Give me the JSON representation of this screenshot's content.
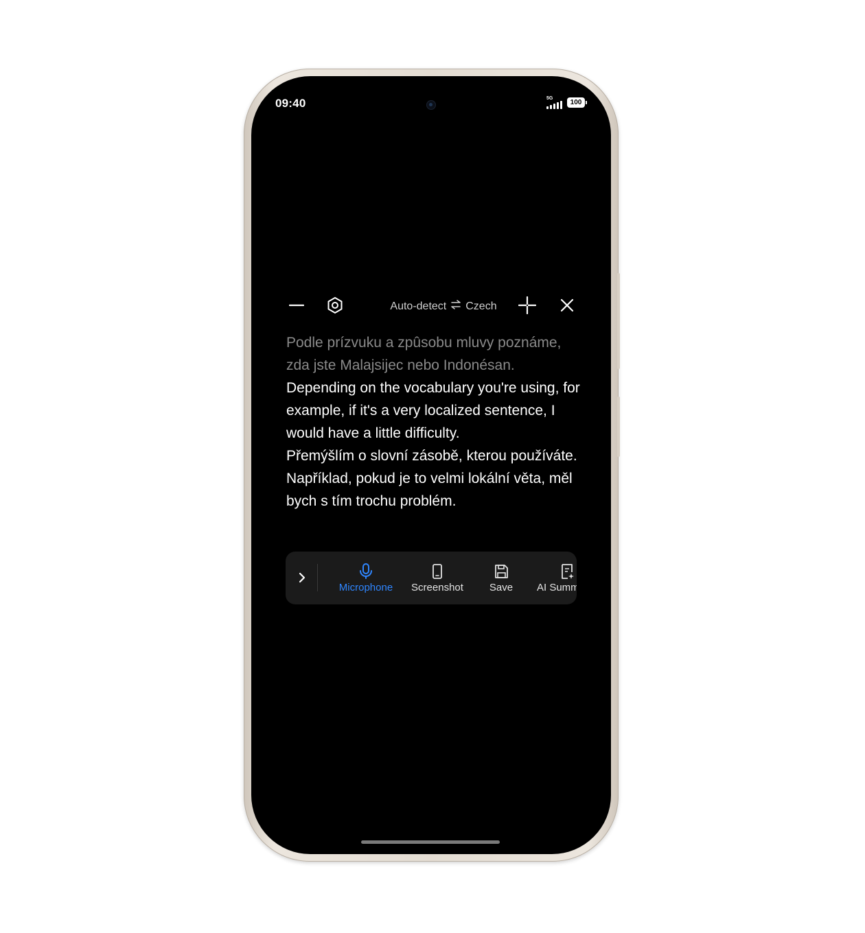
{
  "status_bar": {
    "time": "09:40",
    "network": "5G",
    "battery": "100"
  },
  "top_toolbar": {
    "minimize_icon": "minus-icon",
    "settings_icon": "hexagon-gear-icon",
    "source_language": "Auto-detect",
    "swap_icon": "swap-arrows-icon",
    "target_language": "Czech",
    "resize_icon": "move-cross-icon",
    "close_icon": "close-icon"
  },
  "transcript": {
    "source_text": "Podle prízvuku a zpûsobu mluvy poznáme, zda jste Malajsijec nebo Indonésan.",
    "english_text": "Depending on the vocabulary you're using, for example, if it's a very localized sentence, I would have a little difficulty.",
    "czech_text": "Přemýšlím o slovní zásobě, kterou používáte. Například, pokud je to velmi lokální věta, měl bych s tím trochu problém."
  },
  "action_bar": {
    "expand_icon": "chevron-right-icon",
    "actions": [
      {
        "label": "Microphone",
        "icon": "microphone-icon",
        "active": true
      },
      {
        "label": "Screenshot",
        "icon": "phone-screenshot-icon",
        "active": false
      },
      {
        "label": "Save",
        "icon": "save-icon",
        "active": false
      },
      {
        "label": "AI Summ",
        "icon": "ai-summary-icon",
        "active": false
      }
    ]
  },
  "colors": {
    "accent": "#2f86ff",
    "background": "#000000",
    "source_text": "#8a8a8a",
    "primary_text": "#ffffff",
    "panel": "#1b1b1b"
  }
}
